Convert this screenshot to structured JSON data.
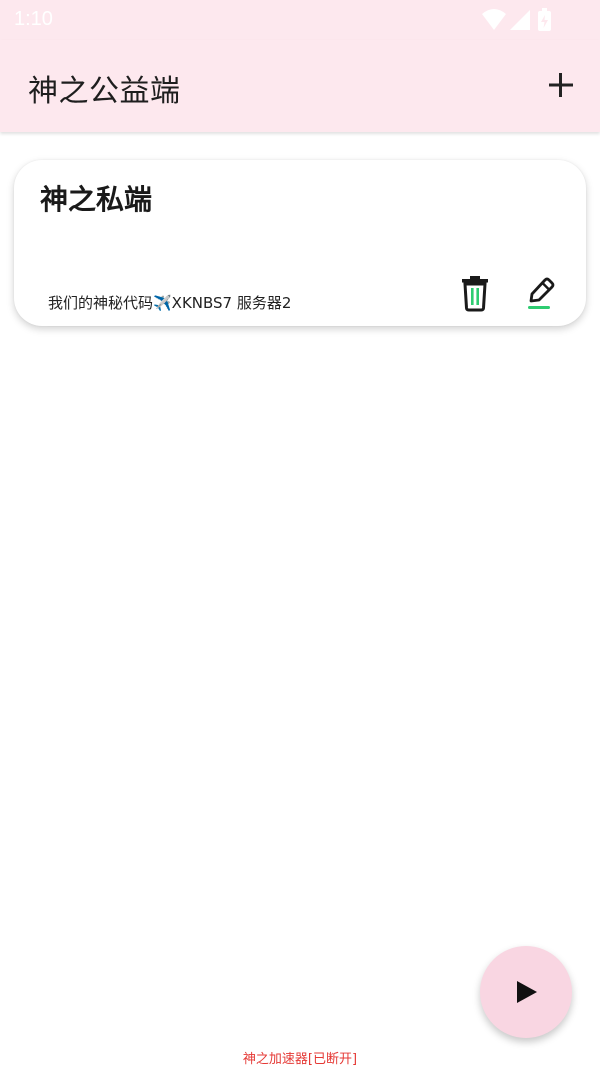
{
  "status_bar": {
    "time": "1:10",
    "icons": [
      "wifi-icon",
      "signal-icon",
      "battery-icon"
    ]
  },
  "app_bar": {
    "title": "神之公益端",
    "add_icon": "plus-icon"
  },
  "card": {
    "title": "神之私端",
    "subtitle": "我们的神秘代码✈️XKNBS7  服务器2",
    "delete_icon": "trash-icon",
    "edit_icon": "pencil-icon",
    "accent_color": "#2ecc71"
  },
  "fab": {
    "icon": "play-icon",
    "background": "#f9d6e2"
  },
  "connection_status": "神之加速器[已断开]",
  "colors": {
    "header_bg": "#fde8ee",
    "status_text": "#e53935"
  }
}
